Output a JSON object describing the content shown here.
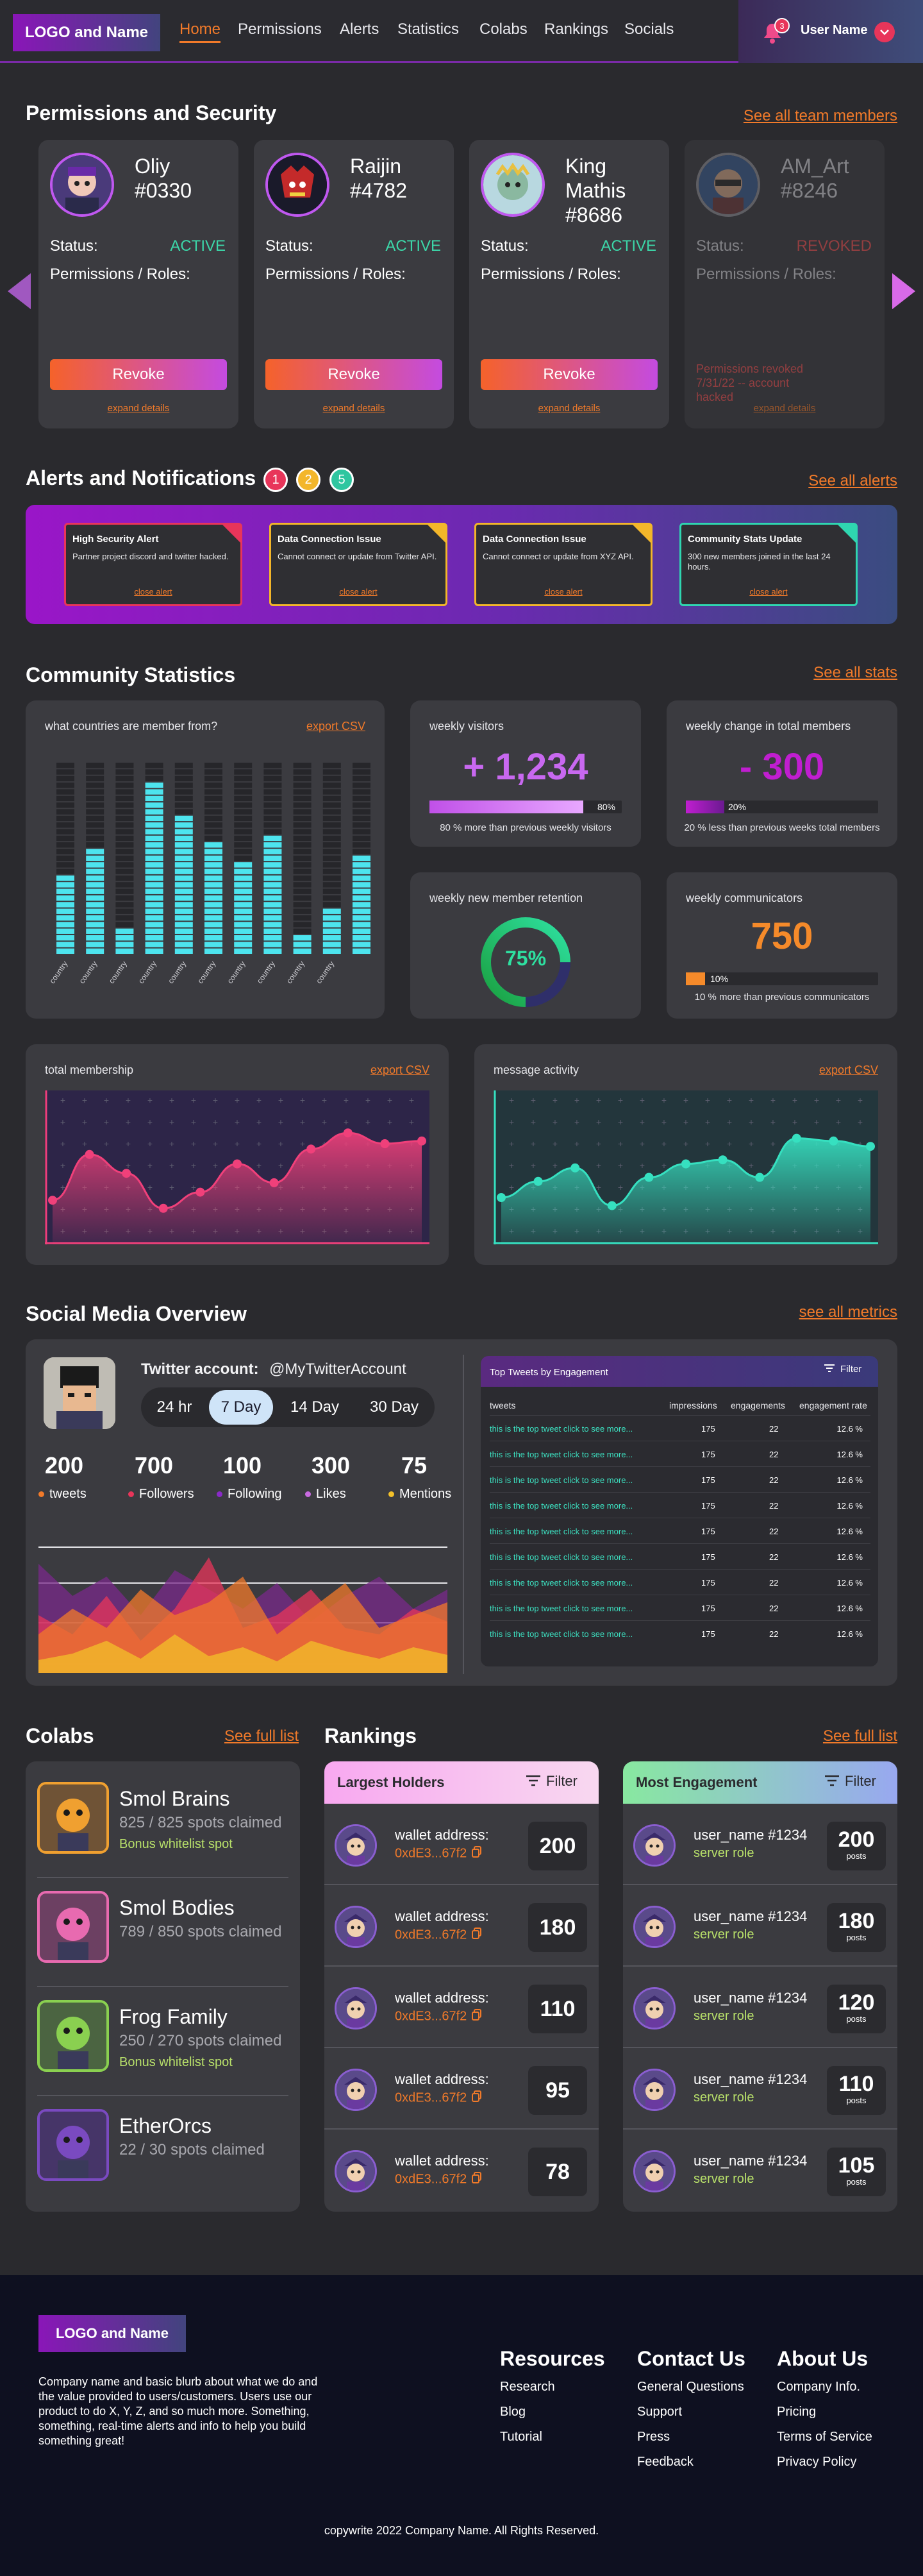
{
  "header": {
    "logo": "LOGO and Name",
    "nav": [
      "Home",
      "Permissions",
      "Alerts",
      "Statistics",
      "Colabs",
      "Rankings",
      "Socials"
    ],
    "notification_count": "3",
    "user_name": "User Name"
  },
  "permissions": {
    "title": "Permissions and Security",
    "see_all": "See all team members",
    "status_label": "Status:",
    "roles_label": "Permissions / Roles:",
    "revoke_label": "Revoke",
    "expand_label": "expand details",
    "members": [
      {
        "name": "Oliy",
        "id": "#0330",
        "status": "ACTIVE"
      },
      {
        "name": "Raijin",
        "id": "#4782",
        "status": "ACTIVE"
      },
      {
        "name": "King Mathis",
        "id": "#8686",
        "status": "ACTIVE"
      },
      {
        "name": "AM_Art",
        "id": "#8246",
        "status": "REVOKED",
        "revoked_note": "Permissions revoked 7/31/22 -- account hacked"
      }
    ]
  },
  "alerts": {
    "title": "Alerts and Notifications",
    "see_all": "See all alerts",
    "badges": [
      "1",
      "2",
      "5"
    ],
    "close_label": "close alert",
    "items": [
      {
        "title": "High Security Alert",
        "desc": "Partner project discord and twitter hacked.",
        "color": "#e8355a"
      },
      {
        "title": "Data Connection Issue",
        "desc": "Cannot connect or update from Twitter API.",
        "color": "#f3b62a"
      },
      {
        "title": "Data Connection Issue",
        "desc": "Cannot connect or update from XYZ API.",
        "color": "#f3b62a"
      },
      {
        "title": "Community Stats Update",
        "desc": "300 new members joined in the last 24 hours.",
        "color": "#2fd6b0"
      }
    ]
  },
  "stats": {
    "title": "Community Statistics",
    "see_all": "See all stats",
    "export": "export CSV",
    "countries": {
      "label": "what countries are member from?",
      "tick": "country"
    },
    "weekly_visitors": {
      "label": "weekly visitors",
      "value": "+ 1,234",
      "pct": "80%",
      "note": "80 % more than previous weekly visitors"
    },
    "weekly_change": {
      "label": "weekly change in total members",
      "value": "- 300",
      "pct": "20%",
      "note": "20 % less than previous weeks total members"
    },
    "retention": {
      "label": "weekly new member retention",
      "value": "75%"
    },
    "communicators": {
      "label": "weekly communicators",
      "value": "750",
      "pct": "10%",
      "note": "10 % more than previous communicators"
    },
    "total_membership": {
      "label": "total membership"
    },
    "message_activity": {
      "label": "message activity"
    }
  },
  "chart_data": [
    {
      "type": "bar",
      "title": "what countries are member from?",
      "categories": [
        "country",
        "country",
        "country",
        "country",
        "country",
        "country",
        "country",
        "country",
        "country",
        "country"
      ],
      "values": [
        12,
        16,
        4,
        26,
        21,
        17,
        14,
        18,
        3,
        7,
        15
      ],
      "ylim": [
        0,
        29
      ]
    },
    {
      "type": "area",
      "title": "total membership",
      "x": [
        0,
        1,
        2,
        3,
        4,
        5,
        6,
        7,
        8,
        9,
        10
      ],
      "values": [
        0.28,
        0.62,
        0.48,
        0.22,
        0.34,
        0.55,
        0.41,
        0.66,
        0.78,
        0.7,
        0.72
      ]
    },
    {
      "type": "area",
      "title": "message activity",
      "x": [
        0,
        1,
        2,
        3,
        4,
        5,
        6,
        7,
        8,
        9,
        10
      ],
      "values": [
        0.3,
        0.42,
        0.52,
        0.24,
        0.45,
        0.55,
        0.58,
        0.45,
        0.74,
        0.72,
        0.68
      ]
    }
  ],
  "social": {
    "title": "Social Media Overview",
    "see_all": "see all metrics",
    "twitter_label": "Twitter account:",
    "handle": "@MyTwitterAccount",
    "ranges": [
      "24 hr",
      "7 Day",
      "14 Day",
      "30 Day"
    ],
    "metrics": [
      {
        "value": "200",
        "label": "tweets",
        "color": "#f17a2a"
      },
      {
        "value": "700",
        "label": "Followers",
        "color": "#e8355a"
      },
      {
        "value": "100",
        "label": "Following",
        "color": "#8a2ac8"
      },
      {
        "value": "300",
        "label": "Likes",
        "color": "#c86ae0"
      },
      {
        "value": "75",
        "label": "Mentions",
        "color": "#f3c02a"
      }
    ],
    "top_tweets": {
      "title": "Top Tweets by Engagement",
      "filter": "Filter",
      "columns": [
        "tweets",
        "impressions",
        "engagements",
        "engagement rate"
      ],
      "rows": [
        {
          "tweet": "this is the top tweet click to see more...",
          "impressions": "175",
          "engagements": "22",
          "rate": "12.6 %"
        },
        {
          "tweet": "this is the top tweet click to see more...",
          "impressions": "175",
          "engagements": "22",
          "rate": "12.6 %"
        },
        {
          "tweet": "this is the top tweet click to see more...",
          "impressions": "175",
          "engagements": "22",
          "rate": "12.6 %"
        },
        {
          "tweet": "this is the top tweet click to see more...",
          "impressions": "175",
          "engagements": "22",
          "rate": "12.6 %"
        },
        {
          "tweet": "this is the top tweet click to see more...",
          "impressions": "175",
          "engagements": "22",
          "rate": "12.6 %"
        },
        {
          "tweet": "this is the top tweet click to see more...",
          "impressions": "175",
          "engagements": "22",
          "rate": "12.6 %"
        },
        {
          "tweet": "this is the top tweet click to see more...",
          "impressions": "175",
          "engagements": "22",
          "rate": "12.6 %"
        },
        {
          "tweet": "this is the top tweet click to see more...",
          "impressions": "175",
          "engagements": "22",
          "rate": "12.6 %"
        },
        {
          "tweet": "this is the top tweet click to see more...",
          "impressions": "175",
          "engagements": "22",
          "rate": "12.6 %"
        }
      ]
    }
  },
  "colabs": {
    "title": "Colabs",
    "see_full": "See full list",
    "items": [
      {
        "name": "Smol Brains",
        "claimed": "825 / 825 spots claimed",
        "bonus": "Bonus whitelist spot"
      },
      {
        "name": "Smol Bodies",
        "claimed": "789 / 850 spots claimed",
        "bonus": ""
      },
      {
        "name": "Frog Family",
        "claimed": "250 / 270 spots claimed",
        "bonus": "Bonus whitelist spot"
      },
      {
        "name": "EtherOrcs",
        "claimed": "22 / 30 spots claimed",
        "bonus": ""
      }
    ]
  },
  "rankings": {
    "title": "Rankings",
    "see_full": "See full list",
    "filter": "Filter",
    "holders": {
      "title": "Largest Holders",
      "label": "wallet address:",
      "address": "0xdE3...67f2",
      "values": [
        "200",
        "180",
        "110",
        "95",
        "78"
      ]
    },
    "engagement": {
      "title": "Most Engagement",
      "user": "user_name #1234",
      "role": "server role",
      "unit": "posts",
      "values": [
        "200",
        "180",
        "120",
        "110",
        "105"
      ]
    }
  },
  "footer": {
    "logo": "LOGO and Name",
    "blurb": "Company name and basic blurb about what we do and the value provided to users/customers. Users use our product to do X, Y, Z, and so much more. Something, something, real-time alerts and info to help you build something great!",
    "resources": {
      "title": "Resources",
      "links": [
        "Research",
        "Blog",
        "Tutorial"
      ]
    },
    "contact": {
      "title": "Contact Us",
      "links": [
        "General Questions",
        "Support",
        "Press",
        "Feedback"
      ]
    },
    "about": {
      "title": "About Us",
      "links": [
        "Company Info.",
        "Pricing",
        "Terms of Service",
        "Privacy Policy"
      ]
    },
    "copyright": "copywrite 2022 Company Name. All Rights Reserved."
  }
}
